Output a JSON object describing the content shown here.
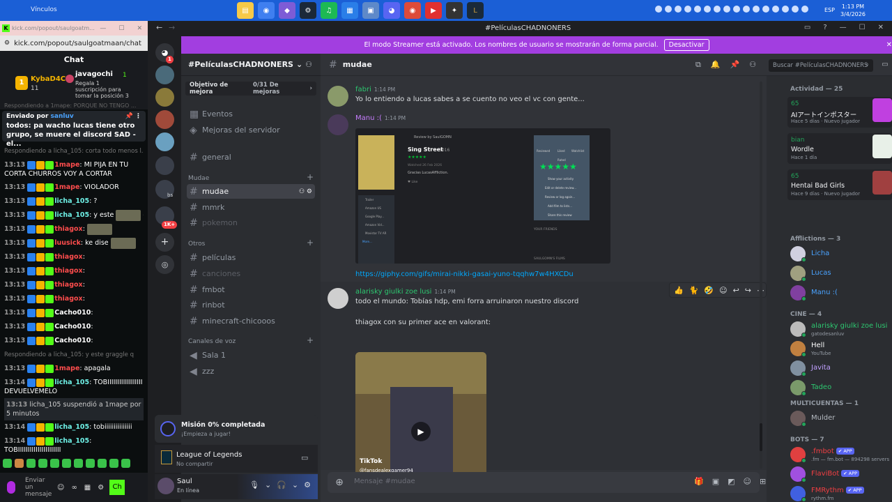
{
  "taskbar": {
    "title": "Vínculos",
    "apps": [
      "folder-icon",
      "chrome-icon",
      "app-icon",
      "steam-icon",
      "spotify-icon",
      "store-icon",
      "explorer-icon",
      "discord-icon",
      "chrome-icon",
      "app-icon",
      "app-icon",
      "league-icon"
    ],
    "lang": "ESP",
    "time": "1:13 PM",
    "date": "3/4/2026"
  },
  "kick": {
    "url_title": "kick.com/popout/saulgoatm...",
    "url": "kick.com/popout/saulgoatmaan/chat",
    "header": "Chat",
    "gift_rank": "1",
    "user1": "KybaD4C",
    "user1_sub": "11",
    "user2": "javagochi",
    "user2_badge": "1",
    "user2_sub": "Regala 1 suscripción para tomar la posición 3",
    "reply_top": "Respondiendo a 1mape: PORQUE NO TENGO ...",
    "sent_label": "Enviado por",
    "sent_user": "sanluv",
    "sent_msg": "todos: pa wacho lucas tiene otro grupo, se muere el discord SAD - el...",
    "messages": [
      {
        "kind": "reply",
        "text": "Respondiendo a licha_105: corta todo menos l..."
      },
      {
        "kind": "wrap",
        "time": "13:13",
        "user": "1mape",
        "color": "#ff4d4d",
        "text": ": MI PIJA EN TU CORTA CHURROS VOY A CORTAR"
      },
      {
        "kind": "msg",
        "time": "13:13",
        "user": "1mape",
        "color": "#ff4d4d",
        "text": ": VIOLADOR"
      },
      {
        "kind": "msg",
        "time": "13:13",
        "user": "licha_105",
        "color": "#6ef0e6",
        "text": ": ?"
      },
      {
        "kind": "msg",
        "time": "13:13",
        "user": "licha_105",
        "color": "#6ef0e6",
        "text": ": y este",
        "img": true,
        "tail": "q"
      },
      {
        "kind": "msg",
        "time": "13:13",
        "user": "thiagox",
        "color": "#ff4d4d",
        "text": ":",
        "img": true
      },
      {
        "kind": "msg",
        "time": "13:13",
        "user": "luusick",
        "color": "#ff4d4d",
        "text": ": ke dise",
        "img": true
      },
      {
        "kind": "msg",
        "time": "13:13",
        "user": "thiagox",
        "color": "#ff4d4d",
        "text": ":"
      },
      {
        "kind": "msg",
        "time": "13:13",
        "user": "thiagox",
        "color": "#ff4d4d",
        "text": ":"
      },
      {
        "kind": "msg",
        "time": "13:13",
        "user": "thiagox",
        "color": "#ff4d4d",
        "text": ":"
      },
      {
        "kind": "msg",
        "time": "13:13",
        "user": "thiagox",
        "color": "#ff4d4d",
        "text": ":"
      },
      {
        "kind": "msg",
        "time": "13:13",
        "user": "Cacho010",
        "color": "#ffffff",
        "text": ":"
      },
      {
        "kind": "msg",
        "time": "13:13",
        "user": "Cacho010",
        "color": "#ffffff",
        "text": ":"
      },
      {
        "kind": "msg",
        "time": "13:13",
        "user": "Cacho010",
        "color": "#ffffff",
        "text": ":"
      },
      {
        "kind": "reply",
        "text": "Respondiendo a licha_105: y este graggle q"
      },
      {
        "kind": "msg",
        "time": "13:13",
        "user": "1mape",
        "color": "#ff4d4d",
        "text": ": apagala"
      },
      {
        "kind": "wrap",
        "time": "13:14",
        "user": "licha_105",
        "color": "#6ef0e6",
        "text": ": TOBIIIIIIIIIIIIIIIIII DEVUELVEMELO"
      },
      {
        "kind": "sys",
        "time": "13:13",
        "text": "licha_105 suspendió a 1mape por 5 minutos"
      },
      {
        "kind": "msg",
        "time": "13:14",
        "user": "licha_105",
        "color": "#6ef0e6",
        "text": ": tobiiiiiiiiiiiiiii"
      },
      {
        "kind": "wrap",
        "time": "13:14",
        "user": "licha_105",
        "color": "#6ef0e6",
        "text": ": TOBIIIIIIIIIIIIIIIIIIIIII"
      }
    ],
    "input_placeholder": "Enviar un mensaje",
    "chat_btn": "Ch"
  },
  "discord": {
    "window_title": "#PelículasCHADNONERS",
    "streamer_text": "El modo Streamer está activado. Los nombres de usuario se mostrarán de forma parcial.",
    "streamer_btn": "Desactivar",
    "server_name": "#PelículasCHADNONERS",
    "boost_label": "Objetivo de mejora",
    "boost_progress": "0/31 De mejoras",
    "guild_badge": "1",
    "guild_badge_2": "1K+",
    "guild_bs": "bs",
    "channels": {
      "eventos": "Eventos",
      "mejoras": "Mejoras del servidor",
      "general": "general",
      "cat_mudae": "Mudae",
      "mudae": "mudae",
      "mmrk": "mmrk",
      "pokemon": "pokemon",
      "cat_otros": "Otros",
      "peliculas": "películas",
      "canciones": "canciones",
      "fmbot": "fmbot",
      "rinbot": "rinbot",
      "minecraft": "minecraft-chicooos",
      "cat_voz": "Canales de voz",
      "sala1": "Sala 1",
      "zzz": "zzz"
    },
    "mission_title": "Misión 0% completada",
    "mission_sub": "¡Empieza a jugar!",
    "game_title": "League of Legends",
    "game_sub": "No compartir",
    "user_name": "Saul",
    "user_status": "En línea",
    "channel_title": "mudae",
    "search_placeholder": "Buscar #PelículasCHADNONERS",
    "messages": {
      "m1_user": "fabri",
      "m1_time": "1:14 PM",
      "m1_text": "Yo lo entiendo a lucas sabes a se cuento no veo el vc con gente...",
      "m2_user": "Manu :(",
      "m2_time": "1:14 PM",
      "m2_link": "https://giphy.com/gifs/mirai-nikki-gasai-yuno-tqqhw7w4HXCDu",
      "m3_user": "alarisky giulki zoe lusi",
      "m3_time": "1:14 PM",
      "m3_text1": "todo el mundo: Tobías hdp, emi forra arruinaron nuestro discord",
      "m3_text2": "thiagox con su primer ace en valorant:",
      "video_brand": "TikTok",
      "video_user": "@fansdealexgamer94"
    },
    "embed": {
      "review_by": "Review by SaulGOMN",
      "movie": "Sing Street",
      "year": "2016",
      "stars": "★★★★★",
      "watched": "Watched 26 Feb 2026",
      "thanks": "Gracias LucasAffliction.",
      "like": "♥ Like",
      "actions": [
        "Reviewed",
        "Liked",
        "Watchlist"
      ],
      "rated": "Rated",
      "menu": [
        "Show your activity",
        "Edit or delete review...",
        "Review or log again...",
        "Add film to lists...",
        "Share this review"
      ],
      "services": [
        "Trailer",
        "Amazon US",
        "Google Play...",
        "Amazon Vid...",
        "Movistar TV AR"
      ],
      "friends": "YOUR FRIENDS",
      "films": "SAULGOMN'S FILMS",
      "more": "More..."
    },
    "composer_placeholder": "Mensaje #mudae",
    "members": {
      "activity_header": "Actividad — 25",
      "activities": [
        {
          "num": "65",
          "title": "AIアートインポスター",
          "sub": "Hace 5 días · Nuevo jugador"
        },
        {
          "num": "bian",
          "title": "Wordle",
          "sub": "Hace 1 día"
        },
        {
          "num": "65",
          "title": "Hentai Bad Girls",
          "sub": "Hace 9 días · Nuevo jugador"
        }
      ],
      "afflictions_header": "Afflictions — 3",
      "afflictions": [
        "Licha",
        "Lucas",
        "Manu :("
      ],
      "cine_header": "CINE — 4",
      "cine": [
        {
          "name": "alarisky giulki zoe lusi",
          "sub": "gatodesanluv"
        },
        {
          "name": "Hell",
          "sub": "YouTube"
        },
        {
          "name": "Javita",
          "sub": ""
        },
        {
          "name": "Tadeo",
          "sub": ""
        }
      ],
      "multi_header": "MULTICUENTAS — 1",
      "multi": [
        "Mulder"
      ],
      "bots_header": "BOTS — 7",
      "bots": [
        {
          "name": ".fmbot",
          "sub": ".fm — fm.bot — 894298 servers"
        },
        {
          "name": "FlaviBot",
          "sub": ""
        },
        {
          "name": "FMRythm",
          "sub": "rythm.fm"
        }
      ],
      "app_tag": "✔ APP"
    }
  }
}
